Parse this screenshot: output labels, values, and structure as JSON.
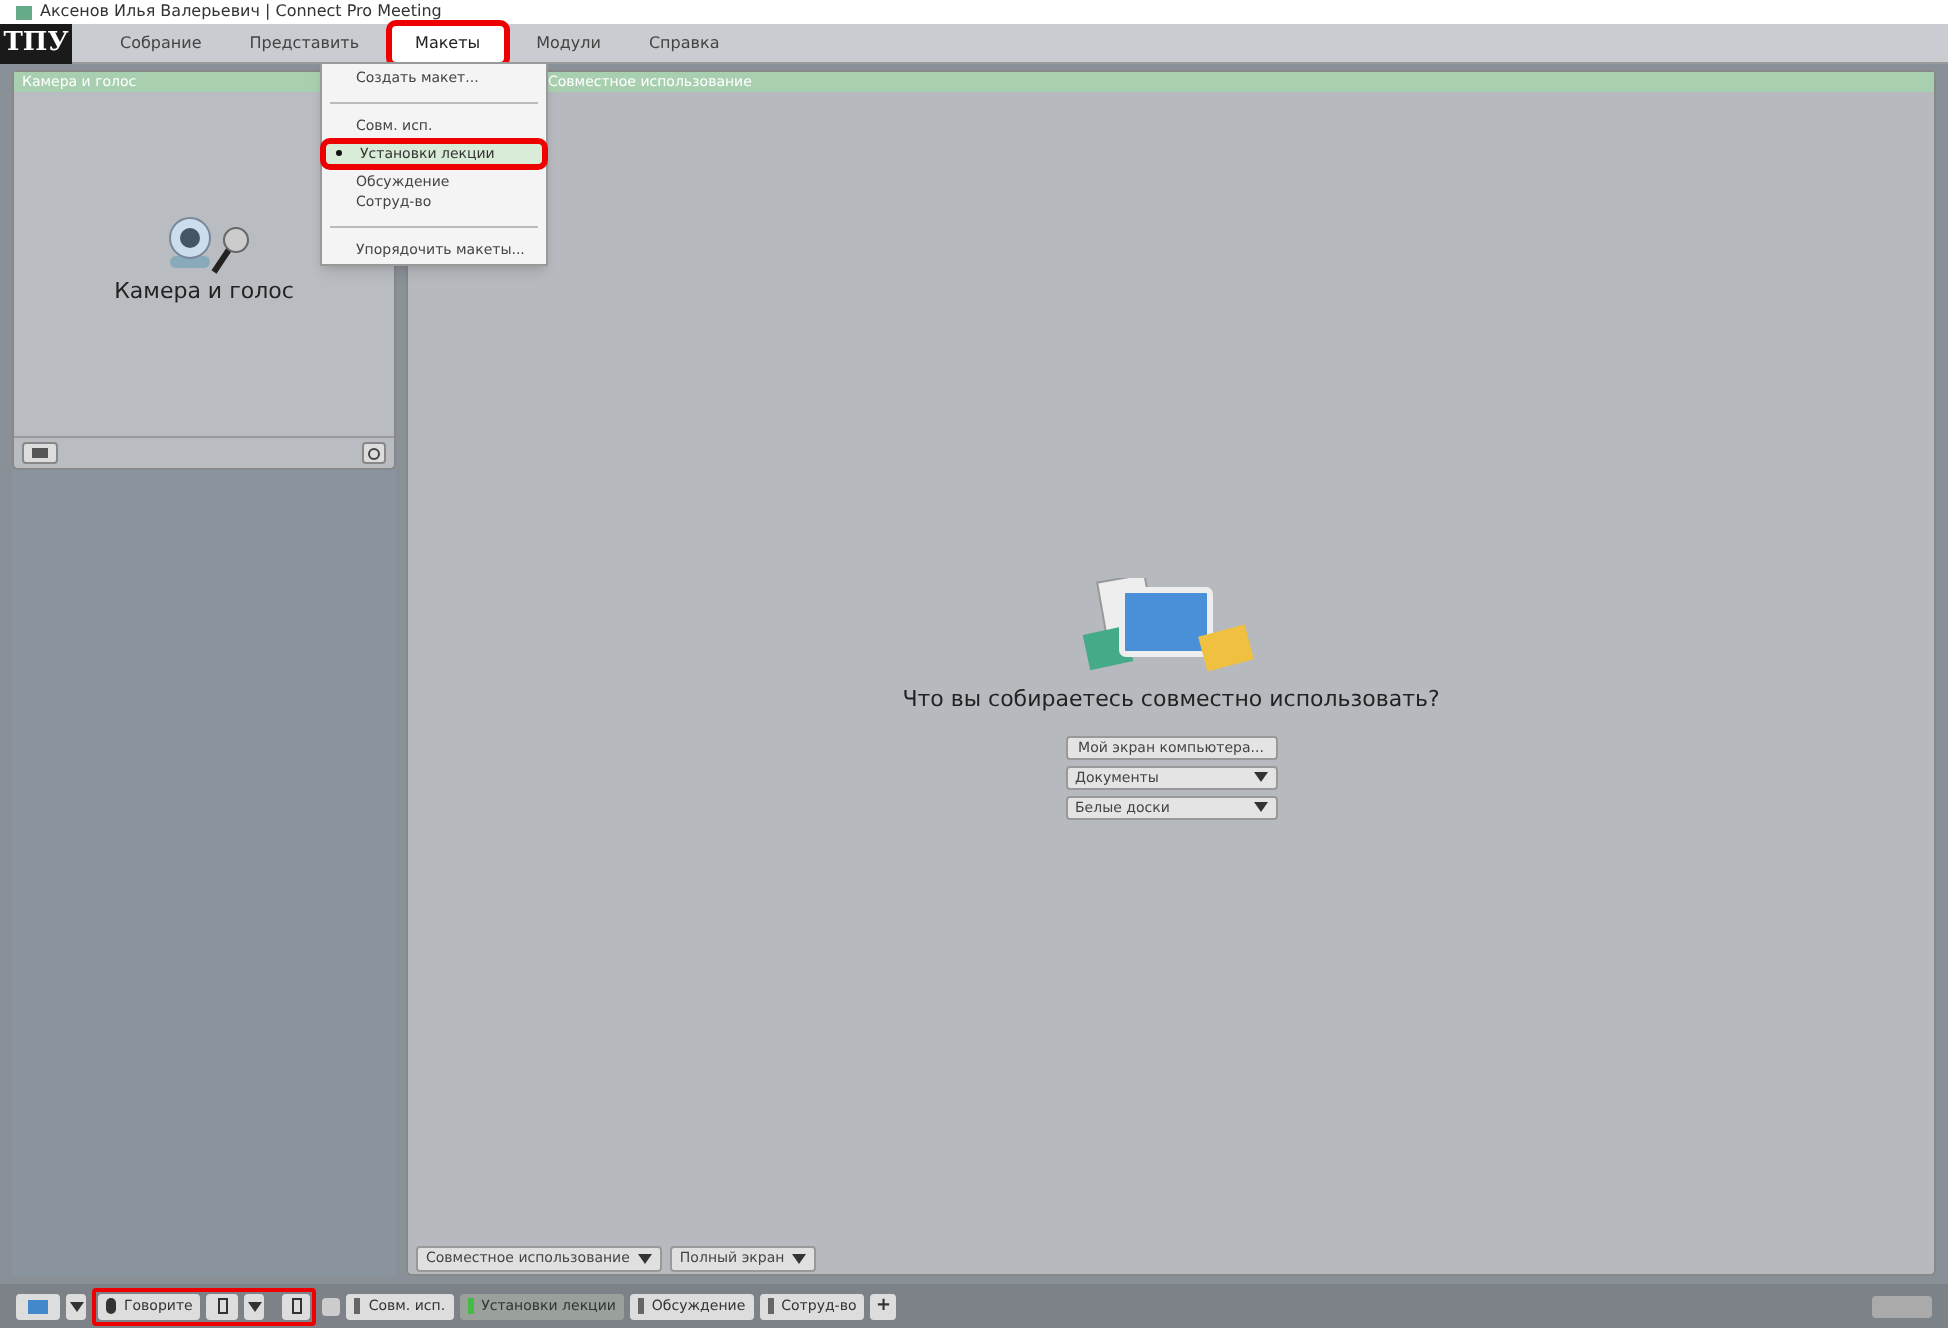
{
  "window": {
    "title": "Аксенов Илья Валерьевич | Connect Pro Meeting"
  },
  "logo": "ТПУ",
  "menu": [
    {
      "label": "Собрание",
      "selected": false
    },
    {
      "label": "Представить",
      "selected": false
    },
    {
      "label": "Макеты",
      "selected": true
    },
    {
      "label": "Модули",
      "selected": false
    },
    {
      "label": "Справка",
      "selected": false
    }
  ],
  "dropdown": [
    {
      "kind": "item",
      "label": "Создать макет...",
      "selected": false
    },
    {
      "kind": "separator"
    },
    {
      "kind": "item",
      "label": "Совм. исп.",
      "selected": false
    },
    {
      "kind": "item",
      "label": "Установки лекции",
      "selected": true
    },
    {
      "kind": "item",
      "label": "Обсуждение",
      "selected": false
    },
    {
      "kind": "item",
      "label": "Сотруд-во",
      "selected": false
    },
    {
      "kind": "separator"
    },
    {
      "kind": "item",
      "label": "Упорядочить макеты...",
      "selected": false
    }
  ],
  "camera_pod": {
    "title": "Камера и голос",
    "label": "Камера и голос"
  },
  "share_pod": {
    "title": "Совместное использование",
    "question": "Что вы собираетесь совместно использовать?",
    "options": [
      {
        "kind": "button",
        "label": "Мой экран компьютера..."
      },
      {
        "kind": "dropdown",
        "label": "Документы"
      },
      {
        "kind": "dropdown",
        "label": "Белые доски"
      }
    ],
    "footer": [
      "Совместное использование",
      "Полный экран"
    ]
  },
  "bottom_bar": {
    "speak": "Говорите",
    "layouts": [
      {
        "label": "Совм. исп.",
        "selected": false
      },
      {
        "label": "Установки лекции",
        "selected": true
      },
      {
        "label": "Обсуждение",
        "selected": false
      },
      {
        "label": "Сотруд-во",
        "selected": false
      }
    ],
    "add": "+"
  }
}
